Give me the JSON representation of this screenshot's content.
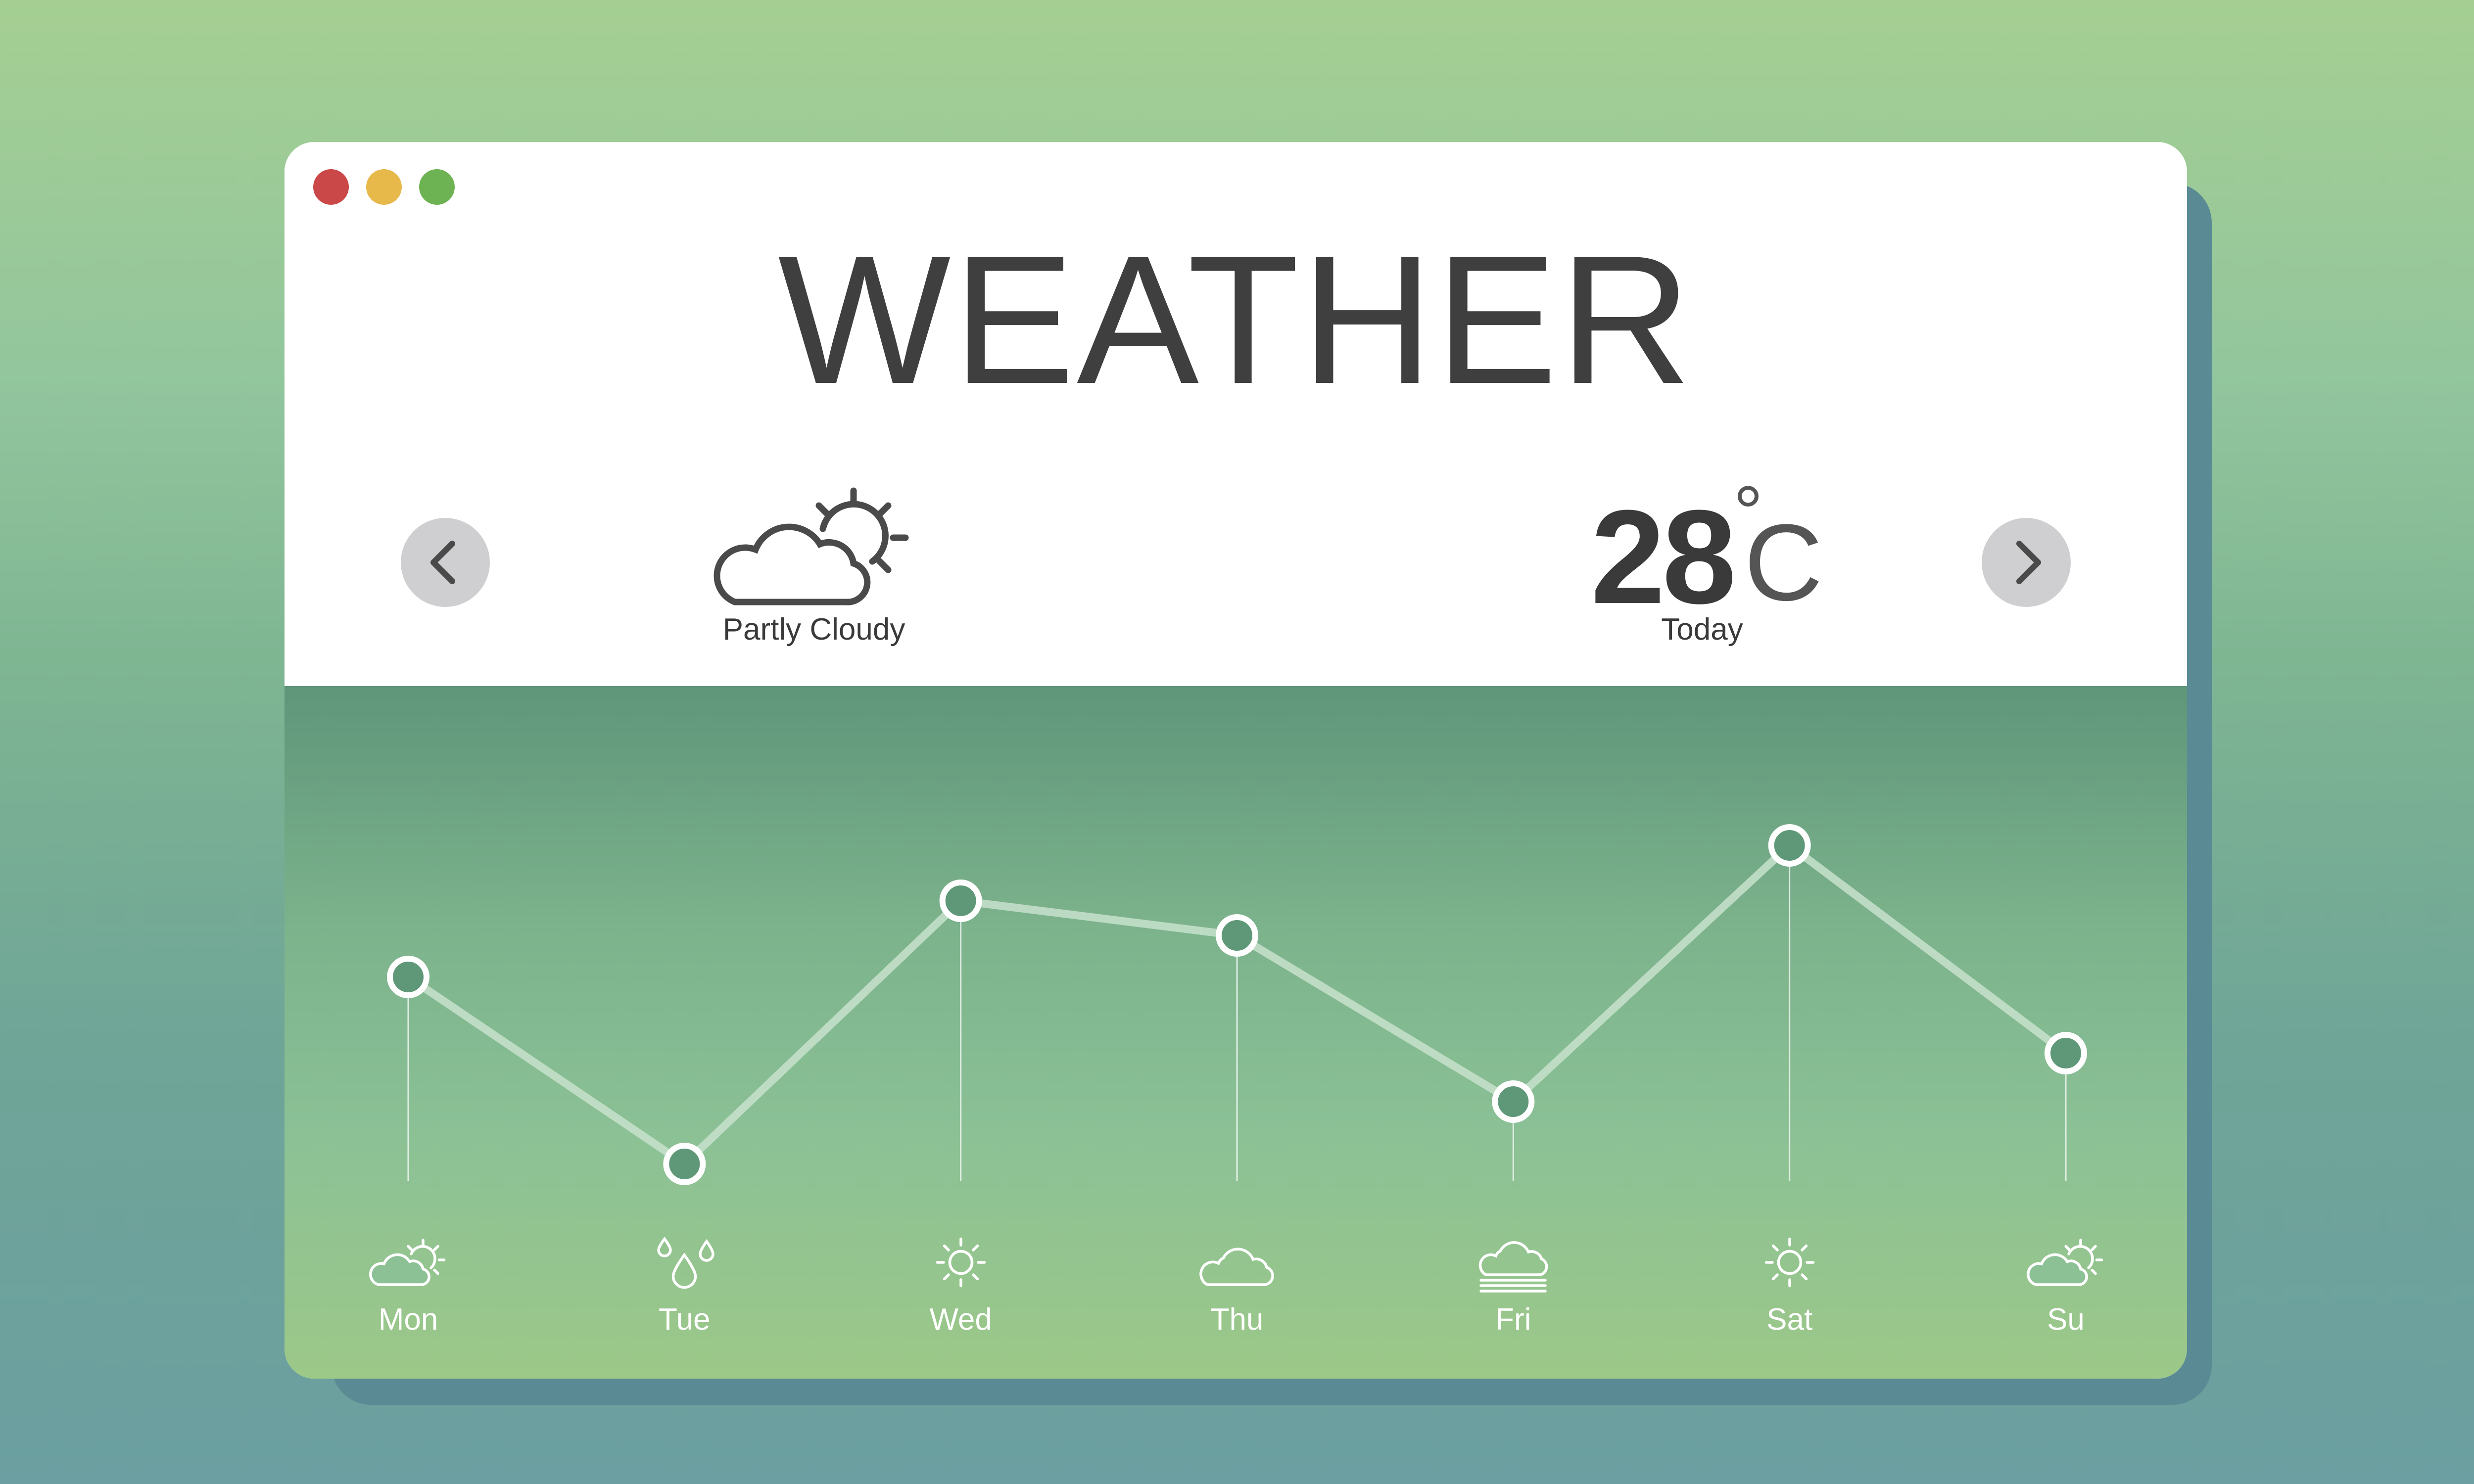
{
  "window": {
    "controls": [
      "close",
      "minimize",
      "maximize"
    ],
    "control_colors": {
      "close": "#cb4848",
      "minimize": "#e7b84a",
      "maximize": "#6db353"
    }
  },
  "app": {
    "title": "WEATHER"
  },
  "current": {
    "condition": "Partly Cloudy",
    "condition_icon": "partly-cloudy-icon",
    "temperature": "28",
    "unit_degree": "°",
    "unit_letter": "C",
    "period_label": "Today"
  },
  "nav": {
    "prev_icon": "chevron-left-icon",
    "next_icon": "chevron-right-icon"
  },
  "colors": {
    "text_dark": "#3f3f3f",
    "panel_top": "#5f957a",
    "panel_bottom": "#9cc888",
    "nav_button": "#cfcfd1",
    "line": "#c8e2cc",
    "point_fill": "#5e9878"
  },
  "chart_data": {
    "type": "line",
    "categories": [
      "Mon",
      "Tue",
      "Wed",
      "Thu",
      "Fri",
      "Sat",
      "Su"
    ],
    "values": [
      58,
      31,
      69,
      64,
      40,
      77,
      47
    ],
    "icons": [
      "partly-cloudy-icon",
      "rain-drops-icon",
      "sun-icon",
      "cloud-icon",
      "fog-icon",
      "sun-icon",
      "partly-cloudy-icon"
    ],
    "ylim": [
      0,
      100
    ],
    "grid": false,
    "legend": "none"
  }
}
